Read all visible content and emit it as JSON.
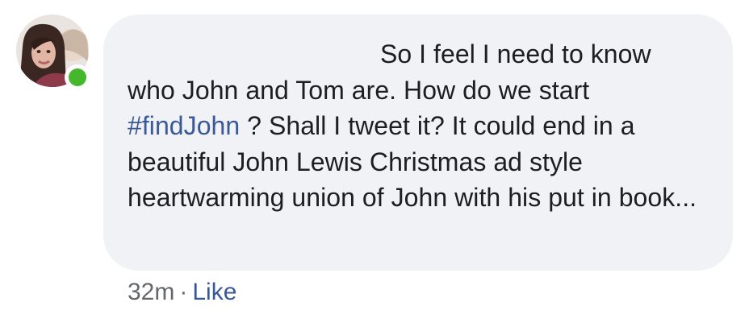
{
  "comment": {
    "text_before": "So I feel I need to know who John and Tom are. How do we start ",
    "hashtag": "#findJohn",
    "text_after": " ? Shall I tweet it? It could end in a beautiful John Lewis Christmas ad style heartwarming union of John with his put in book..."
  },
  "meta": {
    "time": "32m",
    "separator": "·",
    "like_label": "Like"
  },
  "avatar": {
    "online": true,
    "icon": "profile-photo"
  },
  "colors": {
    "bubble": "#f0f2f5",
    "text": "#1c1e21",
    "link": "#3b5998",
    "meta": "#65676b",
    "online_dot": "#44b82a"
  }
}
